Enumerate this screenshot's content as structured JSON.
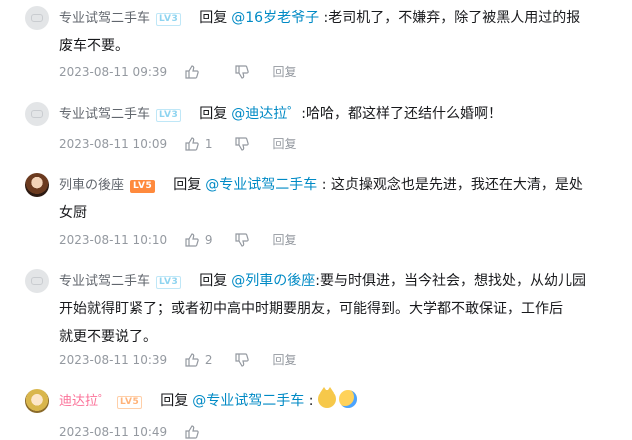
{
  "reply_label": "回复",
  "reply_action": "回复",
  "comments": [
    {
      "username": "专业试驾二手车",
      "level": "LV3",
      "mention": "@16岁老爷子",
      "line1": " :老司机了，不嫌弃，除了被黑人用过的报",
      "line2": "废车不要。",
      "time": "2023-08-11 09:39",
      "likes": ""
    },
    {
      "username": "专业试驾二手车",
      "level": "LV3",
      "mention": "@迪达拉゜",
      "line1": ":哈哈，都这样了还结什么婚啊！",
      "time": "2023-08-11 10:09",
      "likes": "1"
    },
    {
      "username": "列車の後座",
      "level": "LV5",
      "mention": "@专业试驾二手车",
      "line1": " : 这贞操观念也是先进，我还在大清，是处",
      "line2": "女厨",
      "time": "2023-08-11 10:10",
      "likes": "9"
    },
    {
      "username": "专业试驾二手车",
      "level": "LV3",
      "mention": "@列車の後座",
      "line1": ":要与时俱进，当今社会，想找处，从幼儿园",
      "line2": "开始就得盯紧了；或者初中高中时期要朋友，可能得到。大学都不敢保证，工作后",
      "line3": "就更不要说了。",
      "time": "2023-08-11 10:39",
      "likes": "2"
    },
    {
      "username": "迪达拉゜",
      "level": "LV5",
      "mention": "@专业试驾二手车",
      "line1": " : ",
      "time": "2023-08-11 10:49",
      "likes": ""
    }
  ],
  "icons": {
    "like": "thumb-up-icon",
    "dislike": "thumb-down-icon"
  },
  "colors": {
    "mention": "#008ac5",
    "meta": "#9499a0",
    "username_pink": "#fb7299"
  }
}
